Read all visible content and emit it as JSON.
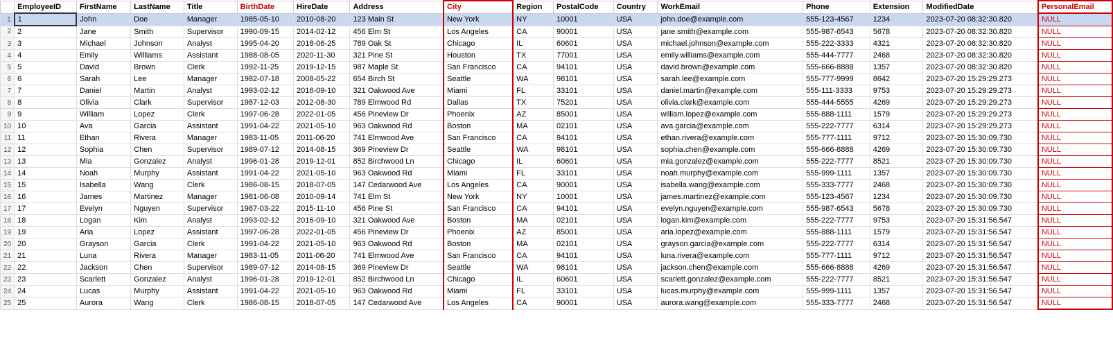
{
  "columns": [
    {
      "key": "rownum",
      "label": ""
    },
    {
      "key": "employeeId",
      "label": "EmployeeID"
    },
    {
      "key": "firstName",
      "label": "FirstName"
    },
    {
      "key": "lastName",
      "label": "LastName"
    },
    {
      "key": "title",
      "label": "Title"
    },
    {
      "key": "birthDate",
      "label": "BirthDate"
    },
    {
      "key": "hireDate",
      "label": "HireDate"
    },
    {
      "key": "address",
      "label": "Address"
    },
    {
      "key": "city",
      "label": "City"
    },
    {
      "key": "region",
      "label": "Region"
    },
    {
      "key": "postalCode",
      "label": "PostalCode"
    },
    {
      "key": "country",
      "label": "Country"
    },
    {
      "key": "workEmail",
      "label": "WorkEmail"
    },
    {
      "key": "phone",
      "label": "Phone"
    },
    {
      "key": "extension",
      "label": "Extension"
    },
    {
      "key": "modifiedDate",
      "label": "ModifiedDate"
    },
    {
      "key": "personalEmail",
      "label": "PersonalEmail"
    }
  ],
  "rows": [
    {
      "rownum": "1",
      "employeeId": "1",
      "firstName": "John",
      "lastName": "Doe",
      "title": "Manager",
      "birthDate": "1985-05-10",
      "hireDate": "2010-08-20",
      "address": "123 Main St",
      "city": "New York",
      "region": "NY",
      "postalCode": "10001",
      "country": "USA",
      "workEmail": "john.doe@example.com",
      "phone": "555-123-4567",
      "extension": "1234",
      "modifiedDate": "2023-07-20 08:32:30.820",
      "personalEmail": "NULL",
      "selected": true
    },
    {
      "rownum": "2",
      "employeeId": "2",
      "firstName": "Jane",
      "lastName": "Smith",
      "title": "Supervisor",
      "birthDate": "1990-09-15",
      "hireDate": "2014-02-12",
      "address": "456 Elm St",
      "city": "Los Angeles",
      "region": "CA",
      "postalCode": "90001",
      "country": "USA",
      "workEmail": "jane.smith@example.com",
      "phone": "555-987-6543",
      "extension": "5678",
      "modifiedDate": "2023-07-20 08:32:30.820",
      "personalEmail": "NULL"
    },
    {
      "rownum": "3",
      "employeeId": "3",
      "firstName": "Michael",
      "lastName": "Johnson",
      "title": "Analyst",
      "birthDate": "1995-04-20",
      "hireDate": "2018-06-25",
      "address": "789 Oak St",
      "city": "Chicago",
      "region": "IL",
      "postalCode": "60601",
      "country": "USA",
      "workEmail": "michael.johnson@example.com",
      "phone": "555-222-3333",
      "extension": "4321",
      "modifiedDate": "2023-07-20 08:32:30.820",
      "personalEmail": "NULL"
    },
    {
      "rownum": "4",
      "employeeId": "4",
      "firstName": "Emily",
      "lastName": "Williams",
      "title": "Assistant",
      "birthDate": "1988-08-05",
      "hireDate": "2020-11-30",
      "address": "321 Pine St",
      "city": "Houston",
      "region": "TX",
      "postalCode": "77001",
      "country": "USA",
      "workEmail": "emily.williams@example.com",
      "phone": "555-444-7777",
      "extension": "2468",
      "modifiedDate": "2023-07-20 08:32:30.820",
      "personalEmail": "NULL"
    },
    {
      "rownum": "5",
      "employeeId": "5",
      "firstName": "David",
      "lastName": "Brown",
      "title": "Clerk",
      "birthDate": "1992-11-25",
      "hireDate": "2019-12-15",
      "address": "987 Maple St",
      "city": "San Francisco",
      "region": "CA",
      "postalCode": "94101",
      "country": "USA",
      "workEmail": "david.brown@example.com",
      "phone": "555-666-8888",
      "extension": "1357",
      "modifiedDate": "2023-07-20 08:32:30.820",
      "personalEmail": "NULL"
    },
    {
      "rownum": "6",
      "employeeId": "6",
      "firstName": "Sarah",
      "lastName": "Lee",
      "title": "Manager",
      "birthDate": "1982-07-18",
      "hireDate": "2008-05-22",
      "address": "654 Birch St",
      "city": "Seattle",
      "region": "WA",
      "postalCode": "98101",
      "country": "USA",
      "workEmail": "sarah.lee@example.com",
      "phone": "555-777-9999",
      "extension": "8642",
      "modifiedDate": "2023-07-20 15:29:29.273",
      "personalEmail": "NULL"
    },
    {
      "rownum": "7",
      "employeeId": "7",
      "firstName": "Daniel",
      "lastName": "Martin",
      "title": "Analyst",
      "birthDate": "1993-02-12",
      "hireDate": "2016-09-10",
      "address": "321 Oakwood Ave",
      "city": "Miami",
      "region": "FL",
      "postalCode": "33101",
      "country": "USA",
      "workEmail": "daniel.martin@example.com",
      "phone": "555-111-3333",
      "extension": "9753",
      "modifiedDate": "2023-07-20 15:29:29.273",
      "personalEmail": "NULL"
    },
    {
      "rownum": "8",
      "employeeId": "8",
      "firstName": "Olivia",
      "lastName": "Clark",
      "title": "Supervisor",
      "birthDate": "1987-12-03",
      "hireDate": "2012-08-30",
      "address": "789 Elmwood Rd",
      "city": "Dallas",
      "region": "TX",
      "postalCode": "75201",
      "country": "USA",
      "workEmail": "olivia.clark@example.com",
      "phone": "555-444-5555",
      "extension": "4269",
      "modifiedDate": "2023-07-20 15:29:29.273",
      "personalEmail": "NULL"
    },
    {
      "rownum": "9",
      "employeeId": "9",
      "firstName": "William",
      "lastName": "Lopez",
      "title": "Clerk",
      "birthDate": "1997-06-28",
      "hireDate": "2022-01-05",
      "address": "456 Pineview Dr",
      "city": "Phoenix",
      "region": "AZ",
      "postalCode": "85001",
      "country": "USA",
      "workEmail": "william.lopez@example.com",
      "phone": "555-888-1111",
      "extension": "1579",
      "modifiedDate": "2023-07-20 15:29:29.273",
      "personalEmail": "NULL"
    },
    {
      "rownum": "10",
      "employeeId": "10",
      "firstName": "Ava",
      "lastName": "Garcia",
      "title": "Assistant",
      "birthDate": "1991-04-22",
      "hireDate": "2021-05-10",
      "address": "963 Oakwood Rd",
      "city": "Boston",
      "region": "MA",
      "postalCode": "02101",
      "country": "USA",
      "workEmail": "ava.garcia@example.com",
      "phone": "555-222-7777",
      "extension": "6314",
      "modifiedDate": "2023-07-20 15:29:29.273",
      "personalEmail": "NULL"
    },
    {
      "rownum": "11",
      "employeeId": "11",
      "firstName": "Ethan",
      "lastName": "Rivera",
      "title": "Manager",
      "birthDate": "1983-11-05",
      "hireDate": "2011-06-20",
      "address": "741 Elmwood Ave",
      "city": "San Francisco",
      "region": "CA",
      "postalCode": "94101",
      "country": "USA",
      "workEmail": "ethan.rivera@example.com",
      "phone": "555-777-1111",
      "extension": "9712",
      "modifiedDate": "2023-07-20 15:30:09.730",
      "personalEmail": "NULL"
    },
    {
      "rownum": "12",
      "employeeId": "12",
      "firstName": "Sophia",
      "lastName": "Chen",
      "title": "Supervisor",
      "birthDate": "1989-07-12",
      "hireDate": "2014-08-15",
      "address": "369 Pineview Dr",
      "city": "Seattle",
      "region": "WA",
      "postalCode": "98101",
      "country": "USA",
      "workEmail": "sophia.chen@example.com",
      "phone": "555-666-8888",
      "extension": "4269",
      "modifiedDate": "2023-07-20 15:30:09.730",
      "personalEmail": "NULL"
    },
    {
      "rownum": "13",
      "employeeId": "13",
      "firstName": "Mia",
      "lastName": "Gonzalez",
      "title": "Analyst",
      "birthDate": "1996-01-28",
      "hireDate": "2019-12-01",
      "address": "852 Birchwood Ln",
      "city": "Chicago",
      "region": "IL",
      "postalCode": "60601",
      "country": "USA",
      "workEmail": "mia.gonzalez@example.com",
      "phone": "555-222-7777",
      "extension": "8521",
      "modifiedDate": "2023-07-20 15:30:09.730",
      "personalEmail": "NULL"
    },
    {
      "rownum": "14",
      "employeeId": "14",
      "firstName": "Noah",
      "lastName": "Murphy",
      "title": "Assistant",
      "birthDate": "1991-04-22",
      "hireDate": "2021-05-10",
      "address": "963 Oakwood Rd",
      "city": "Miami",
      "region": "FL",
      "postalCode": "33101",
      "country": "USA",
      "workEmail": "noah.murphy@example.com",
      "phone": "555-999-1111",
      "extension": "1357",
      "modifiedDate": "2023-07-20 15:30:09.730",
      "personalEmail": "NULL"
    },
    {
      "rownum": "15",
      "employeeId": "15",
      "firstName": "Isabella",
      "lastName": "Wang",
      "title": "Clerk",
      "birthDate": "1986-08-15",
      "hireDate": "2018-07-05",
      "address": "147 Cedarwood Ave",
      "city": "Los Angeles",
      "region": "CA",
      "postalCode": "90001",
      "country": "USA",
      "workEmail": "isabella.wang@example.com",
      "phone": "555-333-7777",
      "extension": "2468",
      "modifiedDate": "2023-07-20 15:30:09.730",
      "personalEmail": "NULL"
    },
    {
      "rownum": "16",
      "employeeId": "16",
      "firstName": "James",
      "lastName": "Martinez",
      "title": "Manager",
      "birthDate": "1981-06-08",
      "hireDate": "2010-09-14",
      "address": "741 Elm St",
      "city": "New York",
      "region": "NY",
      "postalCode": "10001",
      "country": "USA",
      "workEmail": "james.martinez@example.com",
      "phone": "555-123-4567",
      "extension": "1234",
      "modifiedDate": "2023-07-20 15:30:09.730",
      "personalEmail": "NULL"
    },
    {
      "rownum": "17",
      "employeeId": "17",
      "firstName": "Evelyn",
      "lastName": "Nguyen",
      "title": "Supervisor",
      "birthDate": "1987-03-22",
      "hireDate": "2015-11-10",
      "address": "456 Pine St",
      "city": "San Francisco",
      "region": "CA",
      "postalCode": "94101",
      "country": "USA",
      "workEmail": "evelyn.nguyen@example.com",
      "phone": "555-987-6543",
      "extension": "5678",
      "modifiedDate": "2023-07-20 15:30:09.730",
      "personalEmail": "NULL"
    },
    {
      "rownum": "18",
      "employeeId": "18",
      "firstName": "Logan",
      "lastName": "Kim",
      "title": "Analyst",
      "birthDate": "1993-02-12",
      "hireDate": "2016-09-10",
      "address": "321 Oakwood Ave",
      "city": "Boston",
      "region": "MA",
      "postalCode": "02101",
      "country": "USA",
      "workEmail": "logan.kim@example.com",
      "phone": "555-222-7777",
      "extension": "9753",
      "modifiedDate": "2023-07-20 15:31:56.547",
      "personalEmail": "NULL"
    },
    {
      "rownum": "19",
      "employeeId": "19",
      "firstName": "Aria",
      "lastName": "Lopez",
      "title": "Assistant",
      "birthDate": "1997-06-28",
      "hireDate": "2022-01-05",
      "address": "456 Pineview Dr",
      "city": "Phoenix",
      "region": "AZ",
      "postalCode": "85001",
      "country": "USA",
      "workEmail": "aria.lopez@example.com",
      "phone": "555-888-1111",
      "extension": "1579",
      "modifiedDate": "2023-07-20 15:31:56.547",
      "personalEmail": "NULL"
    },
    {
      "rownum": "20",
      "employeeId": "20",
      "firstName": "Grayson",
      "lastName": "Garcia",
      "title": "Clerk",
      "birthDate": "1991-04-22",
      "hireDate": "2021-05-10",
      "address": "963 Oakwood Rd",
      "city": "Boston",
      "region": "MA",
      "postalCode": "02101",
      "country": "USA",
      "workEmail": "grayson.garcia@example.com",
      "phone": "555-222-7777",
      "extension": "6314",
      "modifiedDate": "2023-07-20 15:31:56.547",
      "personalEmail": "NULL"
    },
    {
      "rownum": "21",
      "employeeId": "21",
      "firstName": "Luna",
      "lastName": "Rivera",
      "title": "Manager",
      "birthDate": "1983-11-05",
      "hireDate": "2011-06-20",
      "address": "741 Elmwood Ave",
      "city": "San Francisco",
      "region": "CA",
      "postalCode": "94101",
      "country": "USA",
      "workEmail": "luna.rivera@example.com",
      "phone": "555-777-1111",
      "extension": "9712",
      "modifiedDate": "2023-07-20 15:31:56.547",
      "personalEmail": "NULL"
    },
    {
      "rownum": "22",
      "employeeId": "22",
      "firstName": "Jackson",
      "lastName": "Chen",
      "title": "Supervisor",
      "birthDate": "1989-07-12",
      "hireDate": "2014-08-15",
      "address": "369 Pineview Dr",
      "city": "Seattle",
      "region": "WA",
      "postalCode": "98101",
      "country": "USA",
      "workEmail": "jackson.chen@example.com",
      "phone": "555-666-8888",
      "extension": "4269",
      "modifiedDate": "2023-07-20 15:31:56.547",
      "personalEmail": "NULL"
    },
    {
      "rownum": "23",
      "employeeId": "23",
      "firstName": "Scarlett",
      "lastName": "Gonzalez",
      "title": "Analyst",
      "birthDate": "1996-01-28",
      "hireDate": "2019-12-01",
      "address": "852 Birchwood Ln",
      "city": "Chicago",
      "region": "IL",
      "postalCode": "60601",
      "country": "USA",
      "workEmail": "scarlett.gonzalez@example.com",
      "phone": "555-222-7777",
      "extension": "8521",
      "modifiedDate": "2023-07-20 15:31:56.547",
      "personalEmail": "NULL"
    },
    {
      "rownum": "24",
      "employeeId": "24",
      "firstName": "Lucas",
      "lastName": "Murphy",
      "title": "Assistant",
      "birthDate": "1991-04-22",
      "hireDate": "2021-05-10",
      "address": "963 Oakwood Rd",
      "city": "Miami",
      "region": "FL",
      "postalCode": "33101",
      "country": "USA",
      "workEmail": "lucas.murphy@example.com",
      "phone": "555-999-1111",
      "extension": "1357",
      "modifiedDate": "2023-07-20 15:31:56.547",
      "personalEmail": "NULL"
    },
    {
      "rownum": "25",
      "employeeId": "25",
      "firstName": "Aurora",
      "lastName": "Wang",
      "title": "Clerk",
      "birthDate": "1986-08-15",
      "hireDate": "2018-07-05",
      "address": "147 Cedarwood Ave",
      "city": "Los Angeles",
      "region": "CA",
      "postalCode": "90001",
      "country": "USA",
      "workEmail": "aurora.wang@example.com",
      "phone": "555-333-7777",
      "extension": "2468",
      "modifiedDate": "2023-07-20 15:31:56.547",
      "personalEmail": "NULL"
    }
  ]
}
